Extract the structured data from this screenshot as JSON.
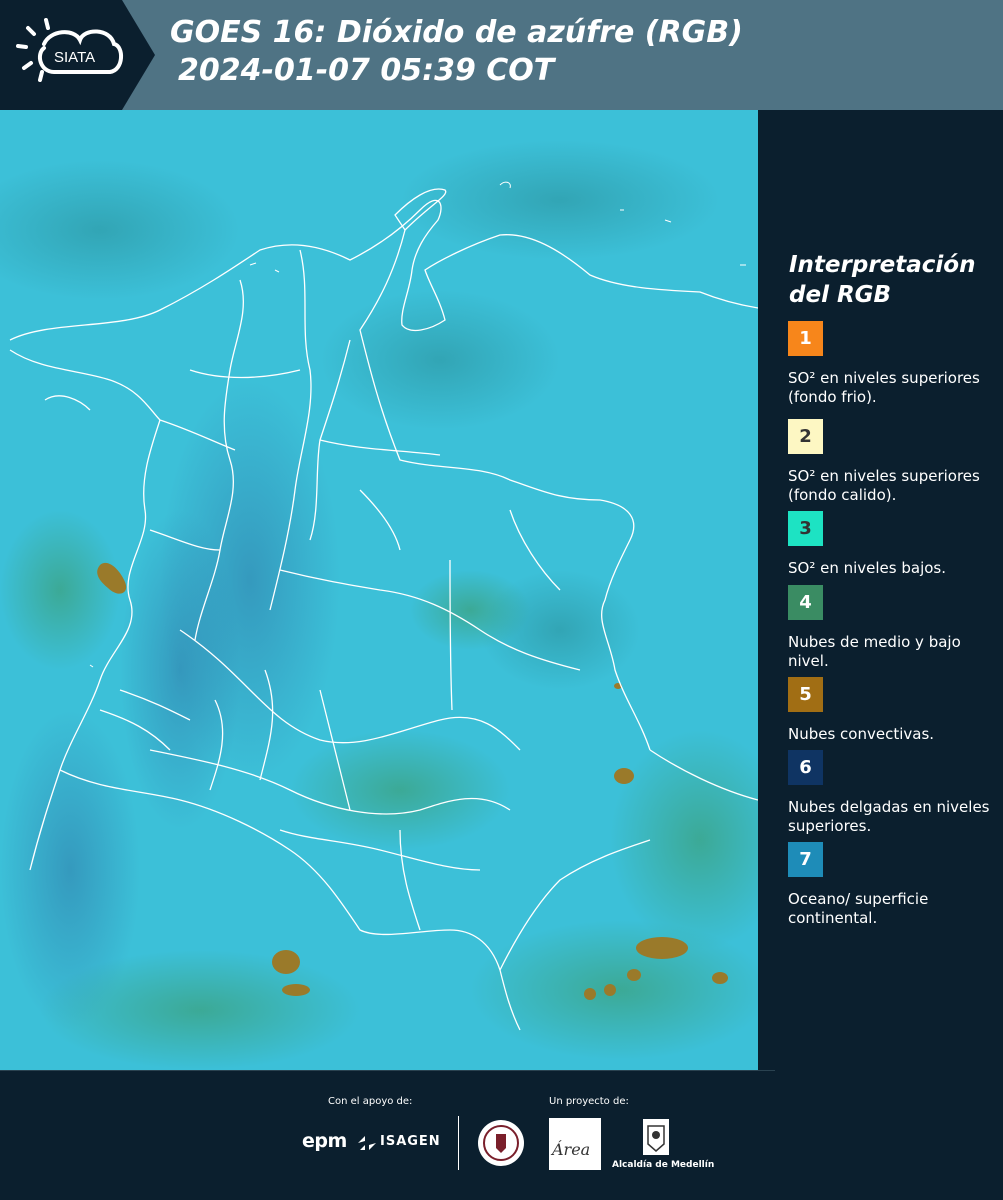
{
  "header": {
    "logo_text": "SIATA",
    "title_line1": "GOES 16: Dióxido de azúfre (RGB)",
    "title_line2": "2024-01-07 05:39 COT"
  },
  "map": {
    "background_color": "#3cc0d8",
    "border_color": "#ffffff"
  },
  "legend": {
    "title_line1": "Interpretación",
    "title_line2": "del RGB",
    "items": [
      {
        "number": "1",
        "color": "#f7861b",
        "label": "SO² en niveles superiores (fondo frio)."
      },
      {
        "number": "2",
        "color": "#fdf7c3",
        "label": "SO² en niveles superiores (fondo calido)."
      },
      {
        "number": "3",
        "color": "#1de3c3",
        "label": "SO² en niveles bajos."
      },
      {
        "number": "4",
        "color": "#3a8c63",
        "label": "Nubes de medio y bajo nivel."
      },
      {
        "number": "5",
        "color": "#a16e14",
        "label": "Nubes convectivas."
      },
      {
        "number": "6",
        "color": "#0f3463",
        "label": "Nubes delgadas en niveles superiores."
      },
      {
        "number": "7",
        "color": "#1e8cb8",
        "label": "Oceano/ superficie continental."
      }
    ]
  },
  "footer": {
    "support_label": "Con el apoyo de:",
    "project_label": "Un proyecto de:",
    "epm_text": "epm",
    "isagen_text": "ISAGEN",
    "area_text": "Área",
    "alcaldia_label": "Alcaldía de Medellín"
  }
}
